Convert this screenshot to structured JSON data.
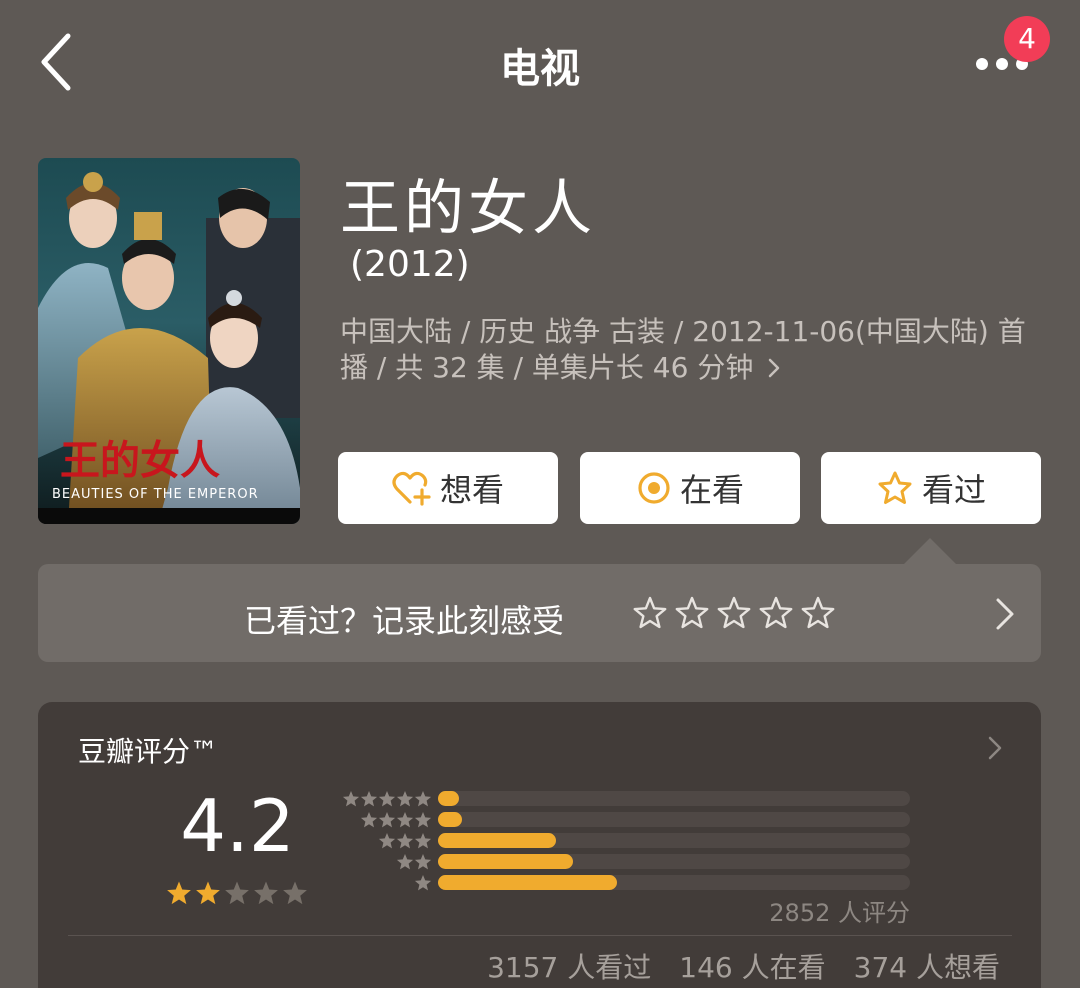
{
  "header": {
    "title": "电视",
    "badge_count": "4"
  },
  "movie": {
    "title": "王的女人",
    "year": "(2012)",
    "meta": "中国大陆 / 历史 战争 古装 / 2012-11-06(中国大陆) 首播 / 共 32 集 / 单集片长 46 分钟",
    "poster": {
      "title_text": "王的女人",
      "subtitle_text": "BEAUTIES OF THE EMPEROR"
    }
  },
  "actions": {
    "want": "想看",
    "watching": "在看",
    "watched": "看过"
  },
  "rate_prompt": {
    "label": "已看过？记录此刻感受",
    "max_stars": 5
  },
  "score": {
    "title": "豆瓣评分™",
    "value": "4.2",
    "stars_filled": 2,
    "stars_total": 5,
    "distribution": [
      {
        "stars": 5,
        "fraction": 0.045
      },
      {
        "stars": 4,
        "fraction": 0.05
      },
      {
        "stars": 3,
        "fraction": 0.25
      },
      {
        "stars": 2,
        "fraction": 0.285
      },
      {
        "stars": 1,
        "fraction": 0.38
      }
    ],
    "rating_count": "2852 人评分",
    "stats": {
      "watched": "3157 人看过",
      "watching": "146 人在看",
      "wish": "374 人想看"
    }
  },
  "colors": {
    "background": "#5e5955",
    "accent_orange": "#f0ab2e",
    "badge_red": "#f23d57",
    "card_dark": "#423c39"
  }
}
